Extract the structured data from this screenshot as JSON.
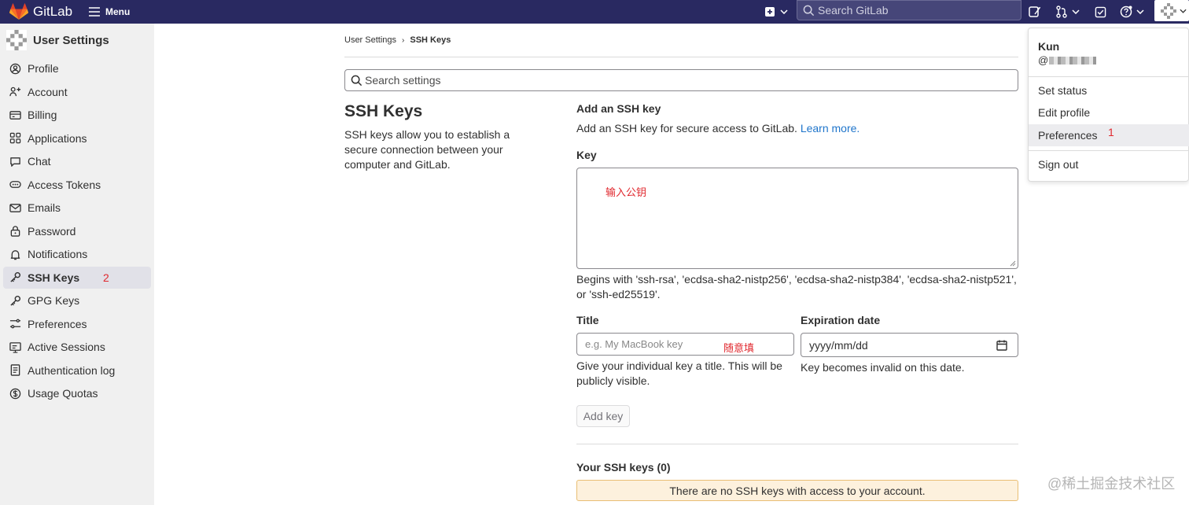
{
  "topbar": {
    "brand": "GitLab",
    "menu_label": "Menu",
    "search_placeholder": "Search GitLab"
  },
  "sidebar": {
    "title": "User Settings",
    "items": [
      {
        "label": "Profile",
        "icon": "profile-icon"
      },
      {
        "label": "Account",
        "icon": "account-icon"
      },
      {
        "label": "Billing",
        "icon": "billing-icon"
      },
      {
        "label": "Applications",
        "icon": "applications-icon"
      },
      {
        "label": "Chat",
        "icon": "chat-icon"
      },
      {
        "label": "Access Tokens",
        "icon": "token-icon"
      },
      {
        "label": "Emails",
        "icon": "email-icon"
      },
      {
        "label": "Password",
        "icon": "lock-icon"
      },
      {
        "label": "Notifications",
        "icon": "bell-icon"
      },
      {
        "label": "SSH Keys",
        "icon": "key-icon",
        "active": true
      },
      {
        "label": "GPG Keys",
        "icon": "key-icon"
      },
      {
        "label": "Preferences",
        "icon": "preferences-icon"
      },
      {
        "label": "Active Sessions",
        "icon": "monitor-icon"
      },
      {
        "label": "Authentication log",
        "icon": "log-icon"
      },
      {
        "label": "Usage Quotas",
        "icon": "quota-icon"
      }
    ],
    "annotation": "2"
  },
  "breadcrumb": {
    "parent": "User Settings",
    "current": "SSH Keys"
  },
  "search_settings_placeholder": "Search settings",
  "page": {
    "title": "SSH Keys",
    "description": "SSH keys allow you to establish a secure connection between your computer and GitLab."
  },
  "form": {
    "heading": "Add an SSH key",
    "subheading": "Add an SSH key for secure access to GitLab.",
    "learn_more": "Learn more.",
    "key_label": "Key",
    "key_annotation": "输入公钥",
    "key_help": "Begins with 'ssh-rsa', 'ecdsa-sha2-nistp256', 'ecdsa-sha2-nistp384', 'ecdsa-sha2-nistp521', or 'ssh-ed25519'.",
    "title_label": "Title",
    "title_placeholder": "e.g. My MacBook key",
    "title_annotation": "随意填",
    "title_help": "Give your individual key a title. This will be publicly visible.",
    "expiration_label": "Expiration date",
    "expiration_value": "yyyy/mm/dd",
    "expiration_help": "Key becomes invalid on this date.",
    "add_key_button": "Add key"
  },
  "keys_list": {
    "heading": "Your SSH keys (0)",
    "empty_message": "There are no SSH keys with access to your account."
  },
  "user_menu": {
    "name": "Kun",
    "username": "@",
    "set_status": "Set status",
    "edit_profile": "Edit profile",
    "preferences": "Preferences",
    "preferences_annotation": "1",
    "sign_out": "Sign out"
  },
  "watermark": "@稀土掘金技术社区",
  "colors": {
    "topbar": "#292961",
    "link": "#1f75cb",
    "annotation": "#e0282e",
    "alert_bg": "#fdf1dd"
  }
}
